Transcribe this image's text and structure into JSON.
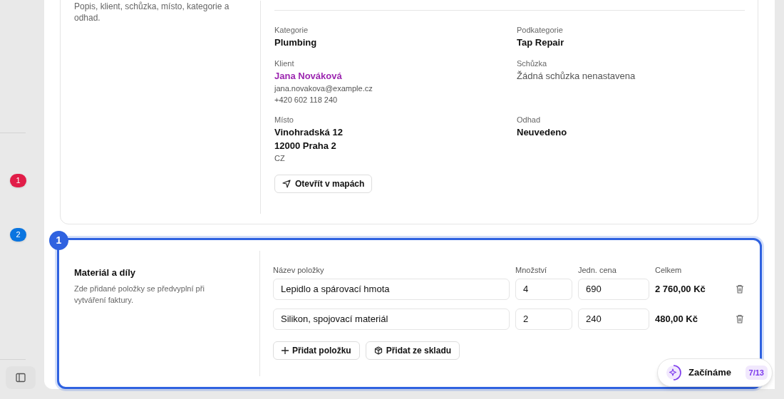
{
  "sidebar": {
    "badges": [
      {
        "label": "1",
        "color": "#e11d48"
      },
      {
        "label": "2",
        "color": "#0a75e0"
      }
    ]
  },
  "details_card": {
    "description": "Popis, klient, schůzka, místo, kategorie a odhad.",
    "fields": [
      {
        "label": "Kategorie",
        "lines": [
          {
            "text": "Plumbing",
            "kind": "value"
          }
        ]
      },
      {
        "label": "Podkategorie",
        "lines": [
          {
            "text": "Tap Repair",
            "kind": "value"
          }
        ]
      },
      {
        "label": "Klient",
        "lines": [
          {
            "text": "Jana Nováková",
            "kind": "link"
          },
          {
            "text": "jana.novakova@example.cz",
            "kind": "small"
          },
          {
            "text": "+420 602 118 240",
            "kind": "small"
          }
        ]
      },
      {
        "label": "Schůzka",
        "lines": [
          {
            "text": "Žádná schůzka nenastavena",
            "kind": "muted"
          }
        ]
      },
      {
        "label": "Místo",
        "lines": [
          {
            "text": "Vinohradská 12",
            "kind": "value"
          },
          {
            "text": "12000 Praha 2",
            "kind": "value"
          },
          {
            "text": "CZ",
            "kind": "small"
          }
        ]
      },
      {
        "label": "Odhad",
        "lines": [
          {
            "text": "Neuvedeno",
            "kind": "value"
          }
        ]
      }
    ],
    "map_button": "Otevřít v mapách"
  },
  "materials_card": {
    "step_badge": "1",
    "title": "Materiál a díly",
    "description": "Zde přidané položky se předvyplní při vytváření faktury.",
    "columns": [
      "Název položky",
      "Množství",
      "Jedn. cena",
      "Celkem"
    ],
    "rows": [
      {
        "name": "Lepidlo a spárovací hmota",
        "quantity": "4",
        "unit_price": "690",
        "total": "2 760,00 Kč"
      },
      {
        "name": "Silikon, spojovací materiál",
        "quantity": "2",
        "unit_price": "240",
        "total": "480,00 Kč"
      }
    ],
    "buttons": [
      {
        "label": "Přidat položku",
        "kind": "plus"
      },
      {
        "label": "Přidat ze skladu",
        "kind": "box"
      }
    ]
  },
  "guide": {
    "label": "Začínáme",
    "progress": "7/13"
  }
}
